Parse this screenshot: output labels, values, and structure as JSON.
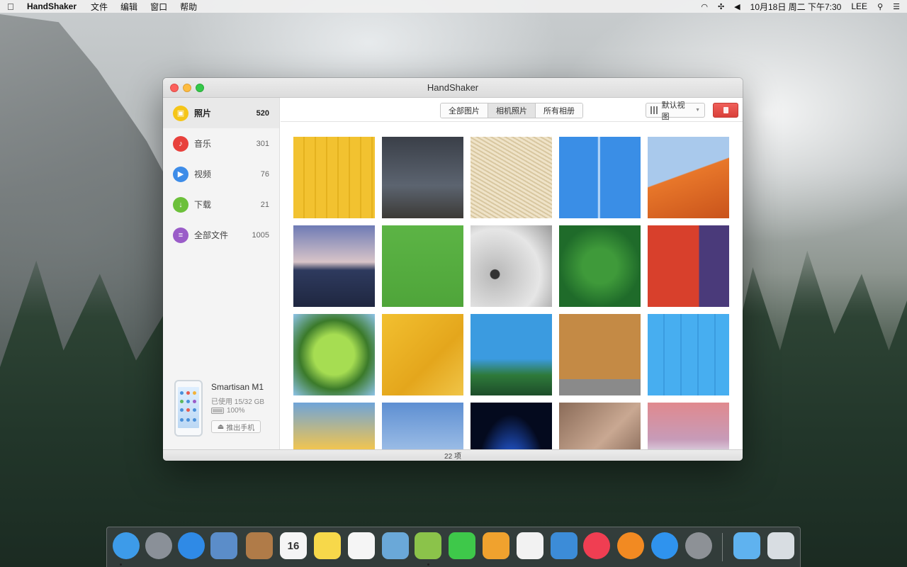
{
  "menubar": {
    "app_name": "HandShaker",
    "menus": [
      "文件",
      "编辑",
      "窗口",
      "帮助"
    ],
    "clock": "10月18日 周二 下午7:30",
    "user": "LEE"
  },
  "window": {
    "title": "HandShaker"
  },
  "sidebar": {
    "items": [
      {
        "label": "照片",
        "count": "520",
        "icon": "photo-icon",
        "color": "#f5c518"
      },
      {
        "label": "音乐",
        "count": "301",
        "icon": "music-icon",
        "color": "#e8413c"
      },
      {
        "label": "视频",
        "count": "76",
        "icon": "play-icon",
        "color": "#3d8ce8"
      },
      {
        "label": "下载",
        "count": "21",
        "icon": "download-icon",
        "color": "#6cc03a"
      },
      {
        "label": "全部文件",
        "count": "1005",
        "icon": "files-icon",
        "color": "#9a5cc8"
      }
    ]
  },
  "device": {
    "name": "Smartisan M1",
    "usage": "已使用 15/32 GB",
    "battery": "100%",
    "battery_level": 1.0,
    "eject_label": "推出手机"
  },
  "toolbar": {
    "tabs": [
      {
        "label": "全部图片",
        "active": false
      },
      {
        "label": "相机照片",
        "active": true
      },
      {
        "label": "所有相册",
        "active": false
      }
    ],
    "view_select": "默认视图",
    "delete_color": "#e24a44"
  },
  "photos": [
    {
      "name": "yellow-wood",
      "bg": "repeating-linear-gradient(90deg,#f2c230 0 14px,#e4b21f 14px 16px)"
    },
    {
      "name": "wind-turbine",
      "bg": "linear-gradient(#3a3f48,#5c6470 60%,#3c3a36)"
    },
    {
      "name": "straw",
      "bg": "repeating-linear-gradient(30deg,#efe3c8 0 3px,#d8c7a0 3px 5px)"
    },
    {
      "name": "blue-sky-trail",
      "bg": "linear-gradient(90deg,#3a8ee6 47%,#dfeefe 49%,#3a8ee6 51%)"
    },
    {
      "name": "orange-dune",
      "bg": "linear-gradient(160deg,#a9c9ec 0 45%,#e8772a 46%,#c9531b 100%)"
    },
    {
      "name": "sunset-sea",
      "bg": "linear-gradient(#6e7bb5,#d8c4c8 45%,#2e3a5e 55%,#1f2740)"
    },
    {
      "name": "green-paper",
      "bg": "linear-gradient(#5cb445,#4fa53a)"
    },
    {
      "name": "elephant",
      "bg": "radial-gradient(circle at 30% 60%,#333 0 6%,#bdbdbd 7%,#e6e6e6 60%,#9a9a9a)"
    },
    {
      "name": "forest-top",
      "bg": "radial-gradient(circle,#3f9a3a 0 30%,#1f6b2a 70%)"
    },
    {
      "name": "red-purple-wall",
      "bg": "linear-gradient(90deg,#d8402c 0 63%,#4a3a7a 63%)"
    },
    {
      "name": "leaf",
      "bg": "radial-gradient(ellipse at 50% 50%,#a6dd52 0 35%,#3b7a2a 60%,#8ec3e8)"
    },
    {
      "name": "gold-foil",
      "bg": "linear-gradient(135deg,#f2c030,#e4a61c 60%,#f0c548)"
    },
    {
      "name": "balloons",
      "bg": "linear-gradient(#3b9be0 0 55%,#2e7a3a 75%,#1d4d2a)"
    },
    {
      "name": "start-mat",
      "bg": "linear-gradient(#c48a45 0 80%,#8a8a8a 80%)"
    },
    {
      "name": "blue-boards",
      "bg": "repeating-linear-gradient(90deg,#47aef0 0 22px,#3a9ce0 22px 24px)"
    },
    {
      "name": "sail-sunset",
      "bg": "linear-gradient(#6fa4d8,#f7c64a 60%,#e99a2a)"
    },
    {
      "name": "golden-gate",
      "bg": "linear-gradient(#5e8fd2,#9cbde6 60%,#c0452a 70%,#2b3b5a)"
    },
    {
      "name": "earth-glow",
      "bg": "radial-gradient(ellipse at 50% 95%,#8fd8ff 0 10%,#1f4fbf 25%,#040a1e 60%)"
    },
    {
      "name": "fabric",
      "bg": "linear-gradient(135deg,#8a6b58,#c9a892 50%,#6b4f40)"
    },
    {
      "name": "snowy-trees",
      "bg": "linear-gradient(#e0898e,#c79bb8 45%,#e7eef6 70%,#8fa5c0)"
    }
  ],
  "status": {
    "count_label": "22 项"
  },
  "dock": {
    "apps": [
      {
        "name": "finder-icon",
        "color": "#3d9be9"
      },
      {
        "name": "launchpad-icon",
        "color": "#8a9098"
      },
      {
        "name": "safari-icon",
        "color": "#2f8ae6"
      },
      {
        "name": "mail-icon",
        "color": "#5b8dc9"
      },
      {
        "name": "contacts-icon",
        "color": "#b07b48"
      },
      {
        "name": "calendar-icon",
        "color": "#f5f5f5",
        "text": "16"
      },
      {
        "name": "notes-icon",
        "color": "#f7d84a"
      },
      {
        "name": "reminders-icon",
        "color": "#f5f5f5"
      },
      {
        "name": "preview-icon",
        "color": "#6aa8d8"
      },
      {
        "name": "android-icon",
        "color": "#8bc34a"
      },
      {
        "name": "facetime-icon",
        "color": "#3ec84a"
      },
      {
        "name": "pages-icon",
        "color": "#f0a22e"
      },
      {
        "name": "numbers-icon",
        "color": "#f2f2f2"
      },
      {
        "name": "keynote-icon",
        "color": "#3c8cd8"
      },
      {
        "name": "itunes-icon",
        "color": "#f03e52"
      },
      {
        "name": "ibooks-icon",
        "color": "#f28a22"
      },
      {
        "name": "app-store-icon",
        "color": "#2f93ee"
      },
      {
        "name": "system-preferences-icon",
        "color": "#8d9196"
      },
      {
        "name": "downloads-folder-icon",
        "color": "#5fb2ef"
      },
      {
        "name": "trash-icon",
        "color": "#d8dde2"
      }
    ]
  }
}
